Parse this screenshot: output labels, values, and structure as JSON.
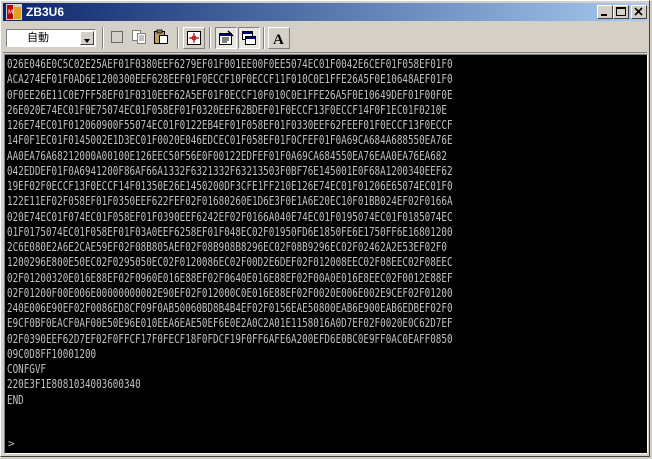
{
  "window": {
    "title": "ZB3U6",
    "icon": "app-icon"
  },
  "title_buttons": [
    "minimize-icon",
    "maximize-icon",
    "close-icon"
  ],
  "toolbar": {
    "mode_select_value": "自動",
    "buttons": [
      {
        "name": "select-button",
        "icon": "dotted-rect-icon",
        "pressed": false
      },
      {
        "name": "copy-button",
        "icon": "copy-icon",
        "pressed": false
      },
      {
        "name": "paste-button",
        "icon": "paste-icon",
        "pressed": false
      },
      {
        "name": "target-button",
        "icon": "crosshair-icon",
        "pressed": false
      },
      {
        "name": "properties-button",
        "icon": "properties-icon",
        "pressed": true
      },
      {
        "name": "window-button",
        "icon": "window-icon",
        "pressed": true
      },
      {
        "name": "font-button",
        "icon": "font-a-icon",
        "pressed": false
      }
    ],
    "font_button_label": "A"
  },
  "terminal": {
    "lines": [
      "026E046E0C5C02E25AEF01F0380EEF6279EF01F001EE00F0EE5074EC01F0042E6CEF01F058EF01F0",
      "ACA274EF01F0AD6E1200300EEF628EEF01F0ECCF10F0ECCF11F010C0E1FFE26A5F0E10648AEF01F0",
      "0F0EE26E11C0E7FF58EF01F0310EEF62A5EF01F0ECCF10F010C0E1FFE26A5F0E10649DEF01F00F0E",
      "26E020E74EC01F0E75074EC01F058EF01F0320EEF62BDEF01F0ECCF13F0ECCF14F0F1EC01F0210E",
      "126E74EC01F012060900F55074EC01F0122EB4EF01F058EF01F0330EEF62FEEF01F0ECCF13F0ECCF",
      "14F0F1EC01F0145002E1D3EC01F0020E046EDCEC01F058EF01F0CFEF01F0A69CA684A688550EA76E",
      "AA0EA76A68212000A00100E126EEC50F56E0F00122EDFEF01F0A69CA684550EA76EAA0EA76EA682",
      "042EDDEF01F0A6941200F86AF66A1332F6321332F63213503F0BF76E145001E0F68A1200340EEF62",
      "19EF02F0ECCF13F0ECCF14F01350E26E1450200DF3CFE1FF210E126E74EC01F01206E65074EC01F0",
      "122E11EF02F058EF01F0350EEF622FEF02F01680260E1D6E3F0E1A6E20EC10F01BB024EF02F0166A",
      "020E74EC01F074EC01F058EF01F0390EEF6242EF02F0166A040E74EC01F0195074EC01F0185074EC",
      "01F0175074EC01F058EF01F03A0EEF6258EF01F048EC02F01950FD6E1850FE6E1750FF6E16801200",
      "2C6E080E2A6E2CAE59EF02F08B805AEF02F08B908B8296EC02F08B9296EC02F02462A2E53EF02F0",
      "1200296E800E50EC02F0295050EC02F0120086EC02F00D2E6DEF02F012008EEC02F08EEC02F08EEC",
      "02F01200320E016E88EF02F0960E016E88EF02F0640E016E88EF02F00A0E016E8EEC02F0012E88EF",
      "02F01200F00E006E00000000002E90EF02F012000C0E016E88EF02F0020E006E002E9CEF02F01200",
      "240E006E90EF02F0086ED8CF09F0AB50060BD8B4B4EF02F0156EAE50800EAB6E900EAB6EDBEF02F0",
      "E9CF0BF0EACF0AF00E50E96E010EEA6EAE50EF6E0E2A0C2A01E1158016A0D7EF02F0020E0C62D7EF",
      "02F0390EEF62D7EF02F0FFCF17F0FECF18F0FDCF19F0FF6AFE6A200EFD6E0BC0E9FF0AC0EAFF0850",
      "09C0D8FF10001200",
      "CONFGVF",
      "220E3F1E8081034003600340",
      "END"
    ],
    "prompt": ">"
  }
}
